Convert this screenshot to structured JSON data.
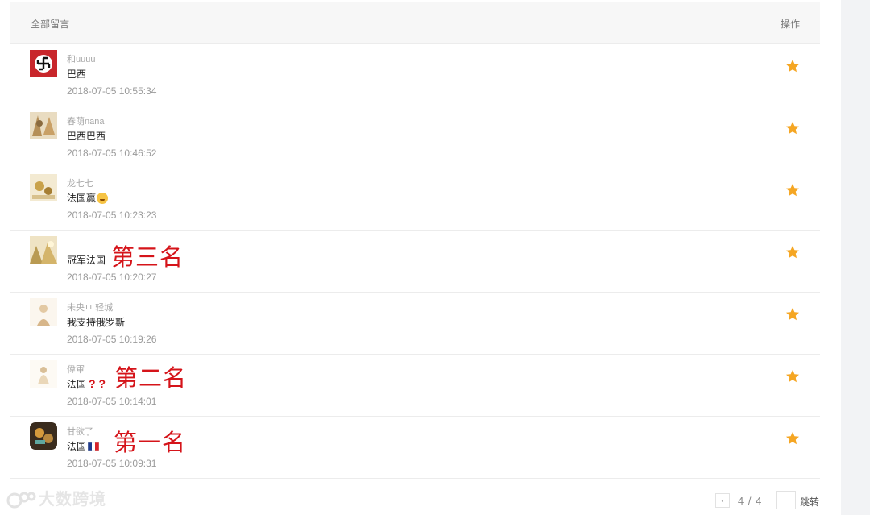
{
  "header": {
    "all_comments": "全部留言",
    "actions": "操作"
  },
  "comments": [
    {
      "nick": "和uuuu",
      "message": "巴西",
      "time": "2018-07-05 10:55:34"
    },
    {
      "nick": "春荫nana",
      "message": "巴西巴西",
      "time": "2018-07-05 10:46:52"
    },
    {
      "nick": "龙七七",
      "message": "法国赢",
      "time": "2018-07-05 10:23:23"
    },
    {
      "nick": "",
      "message": "冠军法国",
      "time": "2018-07-05 10:20:27"
    },
    {
      "nick": "未央ㅁ 轻城",
      "message": "我支持俄罗斯",
      "time": "2018-07-05 10:19:26"
    },
    {
      "nick": "偉軍",
      "message": "法国",
      "time": "2018-07-05 10:14:01"
    },
    {
      "nick": "甘欲了",
      "message": "法国",
      "time": "2018-07-05 10:09:31"
    }
  ],
  "annotations": {
    "third": "第三名",
    "second": "第二名",
    "first": "第一名"
  },
  "question_marks": "? ?",
  "pager": {
    "prev_symbol": "‹",
    "page_text": "4 / 4",
    "jump_label": "跳转"
  },
  "watermark": "大数跨境",
  "colors": {
    "star": "#f5a623",
    "annotation": "#d5141a",
    "header_bg": "#f7f7f7"
  },
  "icons": {
    "row_action": "star-icon",
    "emoji": "grinning-face-icon",
    "flag": "france-flag-icon"
  }
}
